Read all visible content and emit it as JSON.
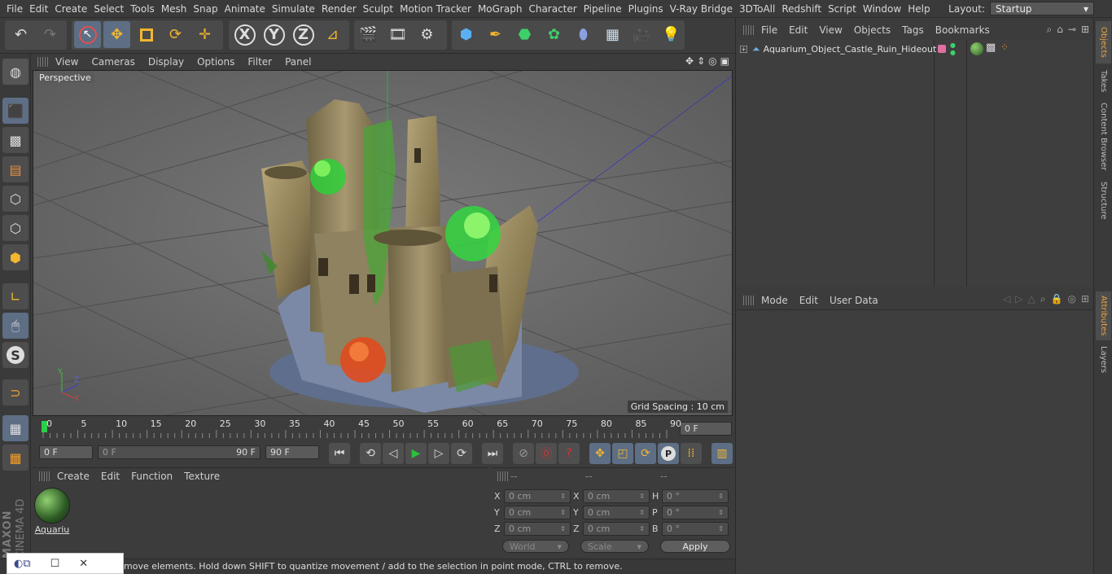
{
  "menubar": {
    "items": [
      "File",
      "Edit",
      "Create",
      "Select",
      "Tools",
      "Mesh",
      "Snap",
      "Animate",
      "Simulate",
      "Render",
      "Sculpt",
      "Motion Tracker",
      "MoGraph",
      "Character",
      "Pipeline",
      "Plugins",
      "V-Ray Bridge",
      "3DToAll",
      "Redshift",
      "Script",
      "Window",
      "Help"
    ],
    "layout_label": "Layout:",
    "layout_value": "Startup"
  },
  "viewport": {
    "menu": [
      "View",
      "Cameras",
      "Display",
      "Options",
      "Filter",
      "Panel"
    ],
    "camera_label": "Perspective",
    "grid_spacing": "Grid Spacing : 10 cm"
  },
  "timeline": {
    "ticks": [
      "0",
      "5",
      "10",
      "15",
      "20",
      "25",
      "30",
      "35",
      "40",
      "45",
      "50",
      "55",
      "60",
      "65",
      "70",
      "75",
      "80",
      "85",
      "90"
    ],
    "current_frame": "0 F",
    "start_field": "0 F",
    "range_start": "0 F",
    "range_end": "90 F",
    "end_field": "90 F"
  },
  "material_panel": {
    "menu": [
      "Create",
      "Edit",
      "Function",
      "Texture"
    ],
    "material_name": "Aquariu"
  },
  "coords": {
    "headers": [
      "--",
      "--",
      "--"
    ],
    "rows": [
      {
        "a": "X",
        "av": "0 cm",
        "b": "X",
        "bv": "0 cm",
        "c": "H",
        "cv": "0 °"
      },
      {
        "a": "Y",
        "av": "0 cm",
        "b": "Y",
        "bv": "0 cm",
        "c": "P",
        "cv": "0 °"
      },
      {
        "a": "Z",
        "av": "0 cm",
        "b": "Z",
        "bv": "0 cm",
        "c": "B",
        "cv": "0 °"
      }
    ],
    "world": "World",
    "scale": "Scale",
    "apply": "Apply"
  },
  "status": {
    "text": "move elements. Hold down SHIFT to quantize movement / add to the selection in point mode, CTRL to remove."
  },
  "objects_panel": {
    "menu": [
      "File",
      "Edit",
      "View",
      "Objects",
      "Tags",
      "Bookmarks"
    ],
    "object_name": "Aquarium_Object_Castle_Ruin_Hideout"
  },
  "attributes_panel": {
    "menu": [
      "Mode",
      "Edit",
      "User Data"
    ]
  },
  "side_tabs": {
    "top": [
      "Objects",
      "Takes",
      "Content Browser",
      "Structure"
    ],
    "bottom": [
      "Attributes",
      "Layers"
    ]
  },
  "branding": {
    "maxon": "MAXON",
    "product": "CINEMA 4D"
  },
  "colors": {
    "accent_active": "#5d6e85",
    "tab_active": "#e8a240",
    "play_green": "#2bbf3a",
    "record_red": "#d93030"
  }
}
